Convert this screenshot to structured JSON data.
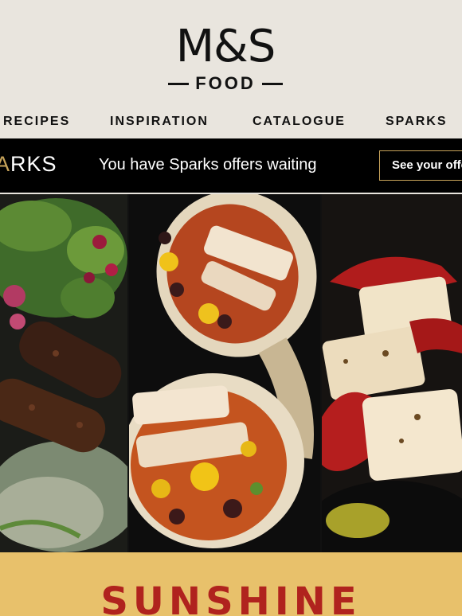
{
  "brand": {
    "name": "M&S",
    "sub": "FOOD"
  },
  "nav": [
    "RECIPES",
    "INSPIRATION",
    "CATALOGUE",
    "SPARKS"
  ],
  "sparks": {
    "logo_partial": "RKS",
    "logo_glyph": "A",
    "message": "You have Sparks offers waiting",
    "button": "See your offers"
  },
  "hero": {
    "panels": [
      "kebab-salad-image",
      "burrito-image",
      "halloumi-peppers-image"
    ]
  },
  "banner": {
    "title": "SUNSHINE"
  },
  "colors": {
    "background": "#e9e5de",
    "sparks_bar": "#000000",
    "gold": "#c7a35a",
    "banner": "#e8c16b",
    "banner_text": "#b0231e"
  }
}
